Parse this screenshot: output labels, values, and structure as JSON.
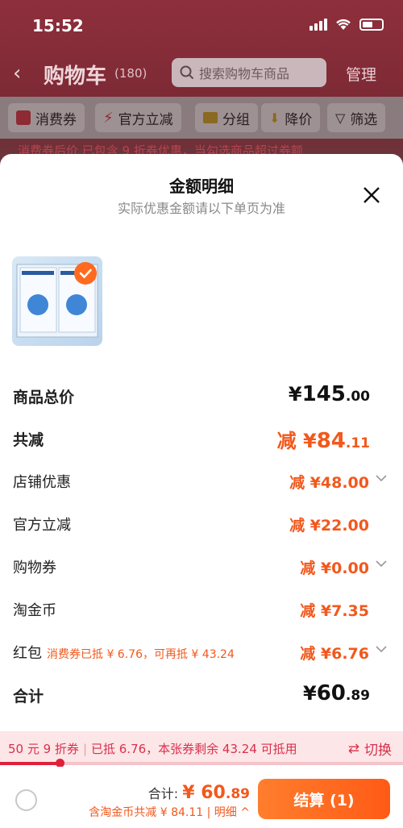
{
  "status_bar": {
    "time": "15:52"
  },
  "cart_header": {
    "title": "购物车",
    "count": "(180)",
    "search_placeholder": "搜索购物车商品",
    "manage": "管理"
  },
  "filters": [
    {
      "label": "消费券",
      "icon": "coupon-icon"
    },
    {
      "label": "官方立减",
      "icon": "lightning-icon"
    },
    {
      "label": "分组",
      "icon": "folder-icon"
    },
    {
      "label": "降价",
      "icon": "price-down-icon"
    },
    {
      "label": "筛选",
      "icon": "filter-icon"
    }
  ],
  "notice": "消费券后价 已包含 9 折券优惠，当勾选商品超过券额",
  "sheet": {
    "title": "金额明细",
    "subtitle": "实际优惠金额请以下单页为准",
    "rows": {
      "total_price": {
        "label": "商品总价",
        "currency": "¥",
        "int": "145",
        "dec": ".00"
      },
      "total_discount": {
        "label": "共减",
        "prefix": "减 ¥",
        "int": "84",
        "dec": ".11"
      },
      "store_discount": {
        "label": "店铺优惠",
        "value": "减 ¥48.00"
      },
      "official_discount": {
        "label": "官方立减",
        "value": "减 ¥22.00"
      },
      "shopping_coupon": {
        "label": "购物券",
        "value": "减 ¥0.00"
      },
      "taojin_coin": {
        "label": "淘金币",
        "value": "减 ¥7.35"
      },
      "red_packet": {
        "label": "红包",
        "note": "消费券已抵 ¥ 6.76，可再抵 ¥ 43.24",
        "value": "减 ¥6.76"
      },
      "subtotal": {
        "label": "合计",
        "currency": "¥",
        "int": "60",
        "dec": ".89"
      }
    }
  },
  "coupon_banner": {
    "coupon": "50 元 9 折券",
    "used": "已抵 6.76，本张券剩余 43.24 可抵用",
    "switch": "切换",
    "progress": 0.15
  },
  "footer": {
    "total_label": "合计: ",
    "total_currency": "¥ ",
    "total_int": "60",
    "total_dec": ".89",
    "discount_detail": "含淘金币共减 ¥ 84.11 | 明细",
    "checkout": "结算 (1)"
  },
  "colors": {
    "accent": "#f2581c",
    "coupon_red": "#d8304d"
  }
}
